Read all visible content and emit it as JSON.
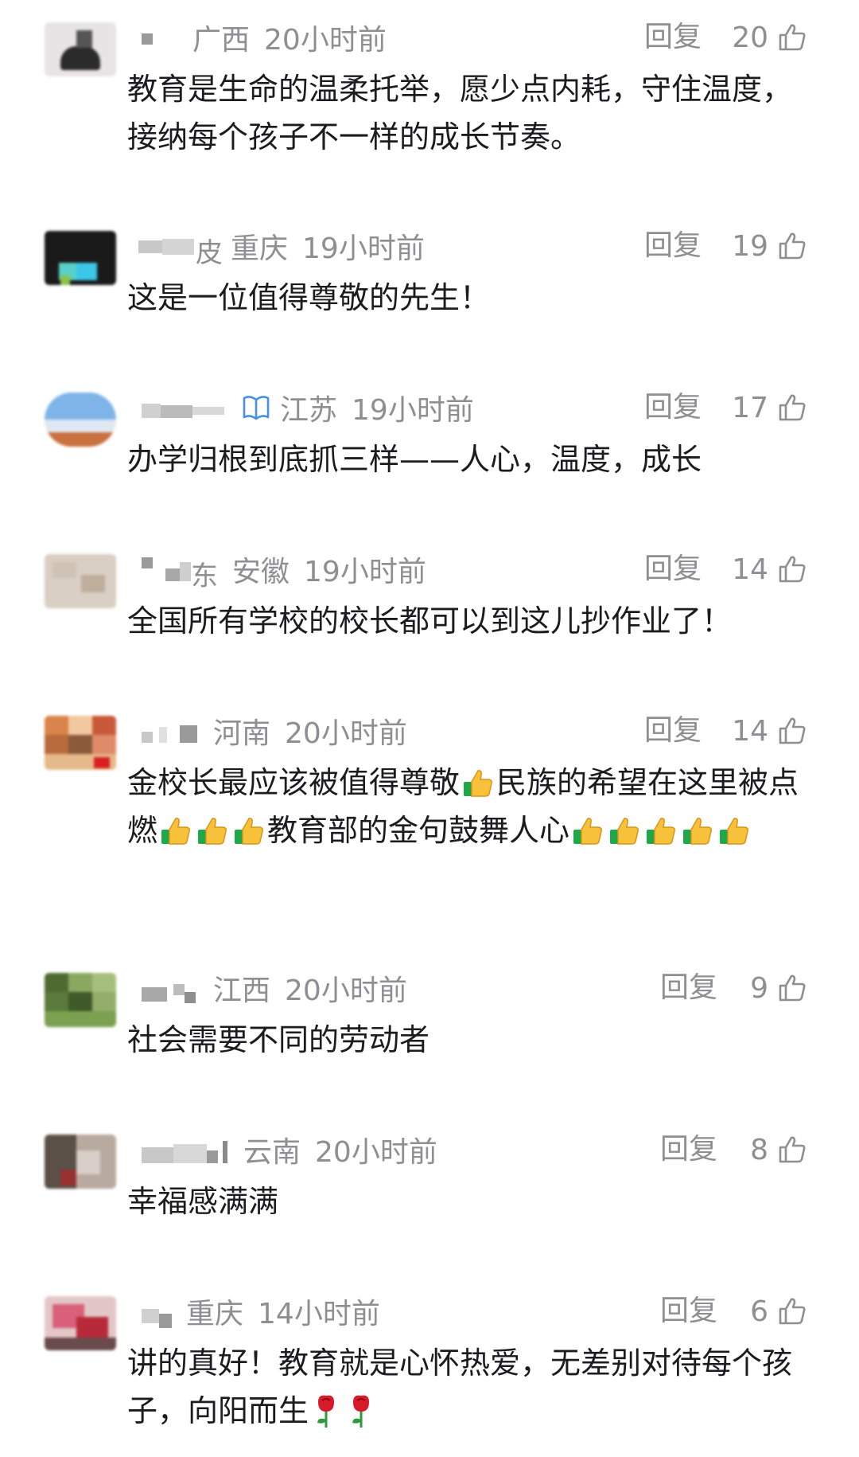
{
  "reply_label": "回复",
  "comments": [
    {
      "username_fragment": "",
      "location": "广西",
      "time": "20小时前",
      "likes": "20",
      "text": "教育是生命的温柔托举，愿少点内耗，守住温度，接纳每个孩子不一样的成长节奏。"
    },
    {
      "username_fragment": "皮",
      "location": "重庆",
      "time": "19小时前",
      "likes": "19",
      "text": "这是一位值得尊敬的先生！"
    },
    {
      "username_fragment": "",
      "location": "江苏",
      "time": "19小时前",
      "likes": "17",
      "text": "办学归根到底抓三样——人心，温度，成长"
    },
    {
      "username_fragment": "东",
      "location": "安徽",
      "time": "19小时前",
      "likes": "14",
      "text": "全国所有学校的校长都可以到这儿抄作业了！"
    },
    {
      "username_fragment": "",
      "location": "河南",
      "time": "20小时前",
      "likes": "14",
      "text_parts": [
        "金校长最应该被值得尊敬",
        "民族的希望在这里被点燃",
        "教育部的金句鼓舞人心"
      ]
    },
    {
      "username_fragment": "",
      "location": "江西",
      "time": "20小时前",
      "likes": "9",
      "text": "社会需要不同的劳动者"
    },
    {
      "username_fragment": "",
      "location": "云南",
      "time": "20小时前",
      "likes": "8",
      "text": "幸福感满满"
    },
    {
      "username_fragment": "",
      "location": "重庆",
      "time": "14小时前",
      "likes": "6",
      "text": "讲的真好！教育就是心怀热爱，无差别对待每个孩子，向阳而生"
    }
  ],
  "icons": {
    "like": "thumbs-up-outline-icon",
    "badge": "open-book-icon",
    "emoji_thumb": "thumbs-up-emoji-icon",
    "emoji_rose": "rose-emoji-icon"
  },
  "colors": {
    "meta_text": "#8e8e93",
    "body_text": "#1c1c1e",
    "badge": "#4a90e2"
  }
}
